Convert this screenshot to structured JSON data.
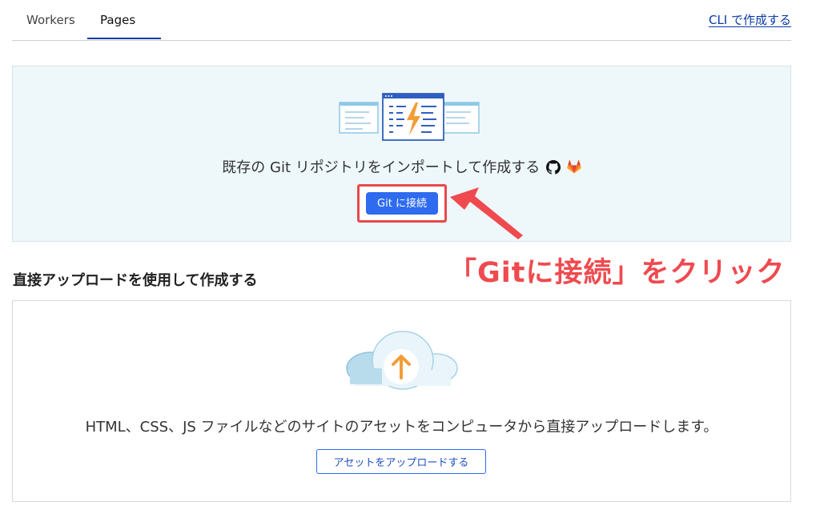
{
  "tabs": [
    {
      "label": "Workers",
      "active": false
    },
    {
      "label": "Pages",
      "active": true
    }
  ],
  "cli_link": "CLI で作成する",
  "git_section": {
    "description": "既存の Git リポジトリをインポートして作成する",
    "icons": [
      "github-icon",
      "gitlab-icon"
    ],
    "button_label": "Git に接続"
  },
  "annotation": {
    "text": "「Gitに接続」をクリック",
    "color": "#ef4a4f"
  },
  "upload_section": {
    "heading": "直接アップロードを使用して作成する",
    "description": "HTML、CSS、JS ファイルなどのサイトのアセットをコンピュータから直接アップロードします。",
    "button_label": "アセットをアップロードする"
  },
  "colors": {
    "accent": "#2e6bef",
    "link": "#0a3aa5",
    "panel_bg": "#eef8fa"
  }
}
